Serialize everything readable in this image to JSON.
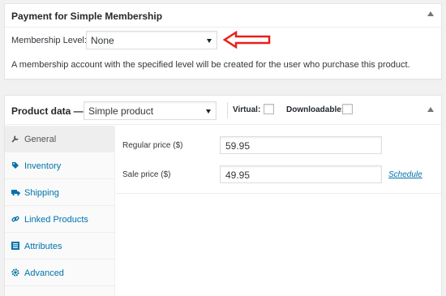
{
  "membership_box": {
    "title": "Payment for Simple Membership",
    "level_label": "Membership Level:",
    "level_value": "None",
    "description": "A membership account with the specified level will be created for the user who purchase this product."
  },
  "annotation_color": "#e8201a",
  "product_data": {
    "title": "Product data —",
    "type_value": "Simple product",
    "virtual_label": "Virtual:",
    "downloadable_label": "Downloadable:",
    "virtual_checked": false,
    "downloadable_checked": false,
    "tabs": [
      {
        "label": "General",
        "icon": "wrench-icon",
        "active": true
      },
      {
        "label": "Inventory",
        "icon": "tag-icon",
        "active": false
      },
      {
        "label": "Shipping",
        "icon": "truck-icon",
        "active": false
      },
      {
        "label": "Linked Products",
        "icon": "link-icon",
        "active": false
      },
      {
        "label": "Attributes",
        "icon": "list-icon",
        "active": false
      },
      {
        "label": "Advanced",
        "icon": "gear-icon",
        "active": false
      }
    ],
    "regular_price_label": "Regular price ($)",
    "regular_price_value": "59.95",
    "sale_price_label": "Sale price ($)",
    "sale_price_value": "49.95",
    "schedule_link": "Schedule"
  }
}
